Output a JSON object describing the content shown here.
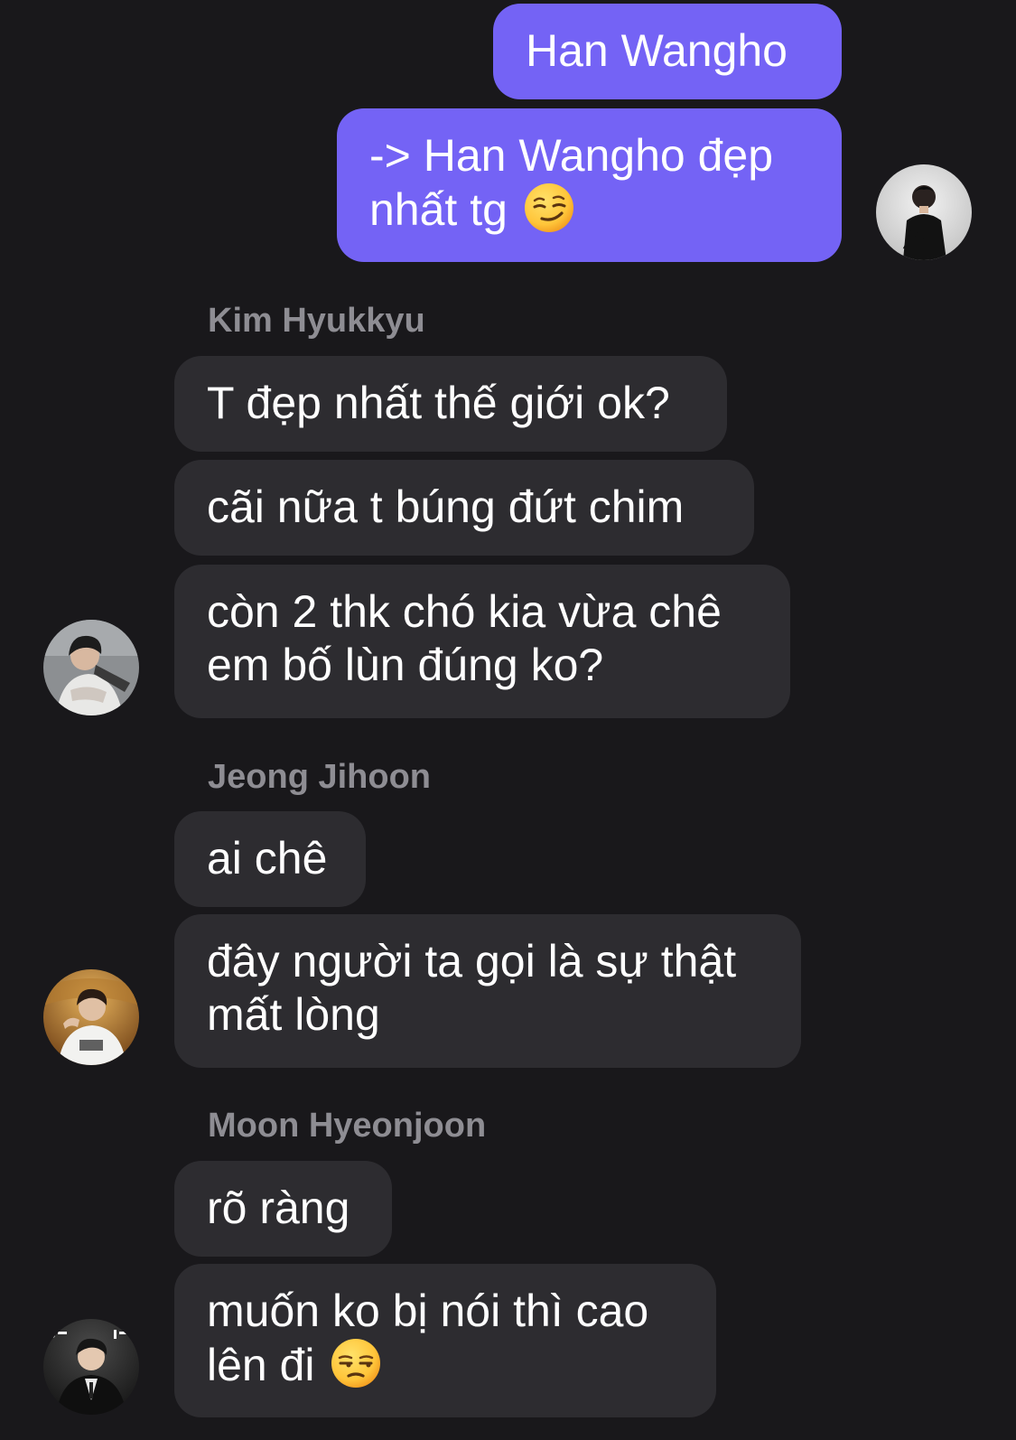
{
  "messages": [
    {
      "id": "m1",
      "direction": "outgoing",
      "lines": [
        "Han Wangho"
      ]
    },
    {
      "id": "m2",
      "direction": "outgoing",
      "lines": [
        "-> Han Wangho đẹp",
        "nhất tg"
      ],
      "emoji": "smirking-face-emoji"
    },
    {
      "id": "m3",
      "direction": "incoming",
      "sender": "Kim Hyukkyu",
      "lines": [
        "T đẹp nhất thế giới ok?"
      ]
    },
    {
      "id": "m4",
      "direction": "incoming",
      "lines": [
        "cãi nữa t búng đứt chim"
      ]
    },
    {
      "id": "m5",
      "direction": "incoming",
      "lines": [
        "còn 2 thk chó kia vừa chê",
        "em bố lùn đúng ko?"
      ]
    },
    {
      "id": "m6",
      "direction": "incoming",
      "sender": "Jeong Jihoon",
      "lines": [
        "ai chê"
      ]
    },
    {
      "id": "m7",
      "direction": "incoming",
      "lines": [
        "đây người ta gọi là sự thật",
        "mất lòng"
      ]
    },
    {
      "id": "m8",
      "direction": "incoming",
      "sender": "Moon Hyeonjoon",
      "lines": [
        "rõ ràng"
      ]
    },
    {
      "id": "m9",
      "direction": "incoming",
      "lines": [
        "muốn ko bị nói thì cao",
        "lên đi"
      ],
      "emoji": "unamused-face-emoji"
    }
  ],
  "avatars": {
    "self": {
      "icon": "avatar-self"
    },
    "kim_hyukkyu": {
      "icon": "avatar-kim-hyukkyu"
    },
    "jeong_jihoon": {
      "icon": "avatar-jeong-jihoon"
    },
    "moon_hyeonjoon": {
      "icon": "avatar-moon-hyeonjoon"
    }
  },
  "colors": {
    "background": "#19181b",
    "outgoing_bubble": "#7463f5",
    "incoming_bubble": "#2d2c30",
    "sender_name": "#8e8d93",
    "message_text": "#ffffff"
  }
}
